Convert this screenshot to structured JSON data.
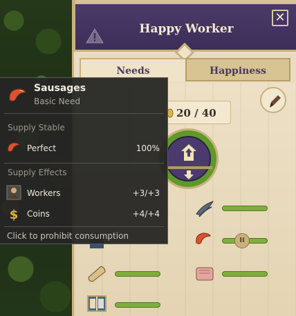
{
  "window": {
    "title": "Happy Worker",
    "close_label": "✕"
  },
  "tabs": [
    {
      "label": "Needs",
      "active": true
    },
    {
      "label": "Happiness",
      "active": false
    }
  ],
  "happiness_counter": {
    "text": "20 / 40"
  },
  "need_bars": [
    {
      "icon": "fish-icon",
      "level": 1.0
    },
    {
      "icon": "sausage-icon",
      "level": 1.0,
      "paused": true
    },
    {
      "icon": "bread-roll-icon",
      "level": 1.0
    },
    {
      "icon": "soap-icon",
      "level": 1.0
    },
    {
      "icon": "book-icon",
      "level": 1.0
    }
  ],
  "tooltip": {
    "item_name": "Sausages",
    "item_type": "Basic Need",
    "supply_section_title": "Supply Stable",
    "supply_row": {
      "label": "Perfect",
      "value": "100%",
      "icon": "sausage-icon"
    },
    "effects_section_title": "Supply Effects",
    "effects": [
      {
        "label": "Workers",
        "value": "+3/+3",
        "icon": "worker-icon"
      },
      {
        "label": "Coins",
        "value": "+4/+4",
        "icon": "coin-icon"
      }
    ],
    "footer": "Click to prohibit consumption"
  },
  "colors": {
    "header": "#3c2e58",
    "panel": "#eadcc2",
    "bar_fill": "#7fae3c",
    "tooltip_bg": "#262624"
  }
}
